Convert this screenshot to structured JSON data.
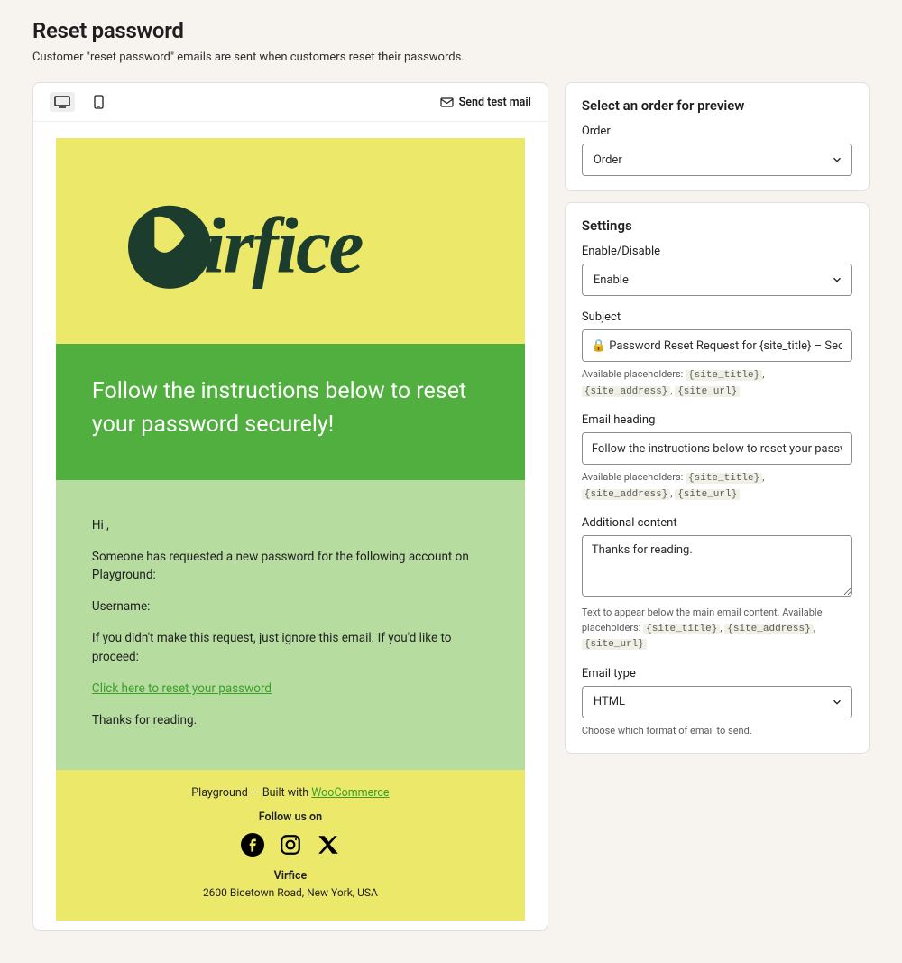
{
  "page": {
    "title": "Reset password",
    "subtitle": "Customer \"reset password\" emails are sent when customers reset their passwords."
  },
  "toolbar": {
    "send_test_label": "Send test mail"
  },
  "email": {
    "heading": "Follow the instructions below to reset your password securely!",
    "body": {
      "greeting": "Hi ,",
      "requested": "Someone has requested a new password for the following account on Playground:",
      "username_label": "Username:",
      "ignore": "If you didn't make this request, just ignore this email. If you'd like to proceed:",
      "reset_link": "Click here to reset your password",
      "thanks": "Thanks for reading."
    },
    "footer": {
      "built_prefix": "Playground — Built with ",
      "built_link": "WooCommerce",
      "follow": "Follow us on",
      "store_name": "Virfice",
      "address": "2600 Bicetown Road, New York, USA"
    }
  },
  "preview_panel": {
    "title": "Select an order for preview",
    "order_label": "Order",
    "order_value": "Order"
  },
  "settings_panel": {
    "title": "Settings",
    "enable_label": "Enable/Disable",
    "enable_value": "Enable",
    "subject_label": "Subject",
    "subject_value": "🔒 Password Reset Request for {site_title} – Secure Your Account",
    "heading_label": "Email heading",
    "heading_value": "Follow the instructions below to reset your password securely!",
    "additional_label": "Additional content",
    "additional_value": "Thanks for reading.",
    "additional_help": "Text to appear below the main email content. Available placeholders: ",
    "email_type_label": "Email type",
    "email_type_value": "HTML",
    "email_type_help": "Choose which format of email to send.",
    "placeholders_prefix": "Available placeholders: ",
    "ph1": "{site_title}",
    "ph2": "{site_address}",
    "ph3": "{site_url}"
  }
}
